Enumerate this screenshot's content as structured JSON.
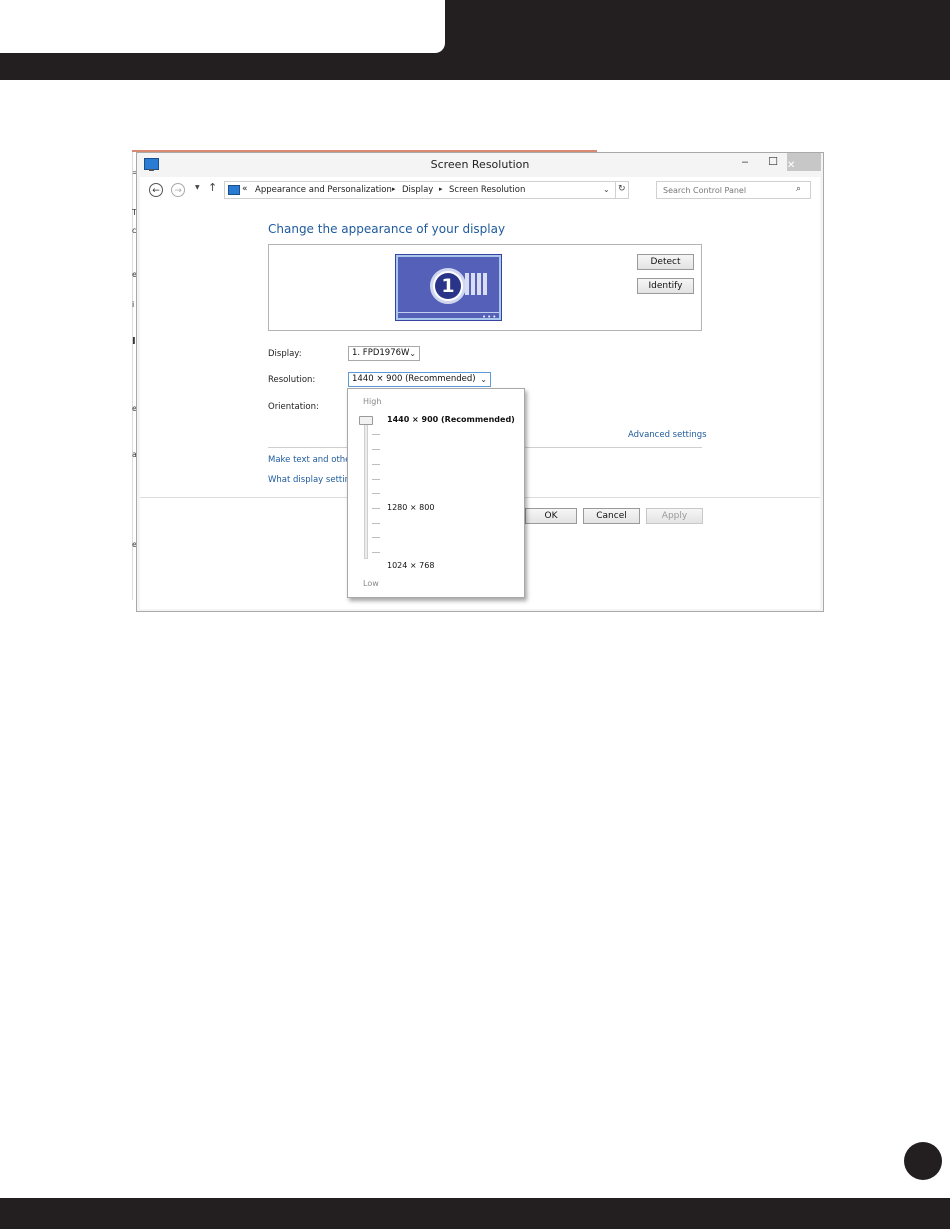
{
  "window": {
    "title": "Screen Resolution",
    "controls": {
      "minimize": "‒",
      "maximize": "☐",
      "close": "✕"
    }
  },
  "address_bar": {
    "overflow": "«",
    "crumbs": [
      "Appearance and Personalization",
      "Display",
      "Screen Resolution"
    ],
    "separator": "▸",
    "search_placeholder": "Search Control Panel"
  },
  "main": {
    "heading": "Change the appearance of your display",
    "monitor_number": "1",
    "detect_label": "Detect",
    "identify_label": "Identify",
    "display_label": "Display:",
    "display_value": "1. FPD1976W",
    "resolution_label": "Resolution:",
    "resolution_value": "1440 × 900 (Recommended)",
    "orientation_label": "Orientation:",
    "advanced_link": "Advanced settings",
    "link_text_size": "Make text and other",
    "link_display_settings": "What display setting",
    "ok_label": "OK",
    "cancel_label": "Cancel",
    "apply_label": "Apply"
  },
  "resolution_dropdown": {
    "high_label": "High",
    "low_label": "Low",
    "options": [
      "1440 × 900 (Recommended)",
      "1280 × 800",
      "1024 × 768"
    ],
    "selected_fraction": 1.0
  },
  "page": {
    "accent": "#231f20",
    "link_color": "#1e5a9c"
  }
}
